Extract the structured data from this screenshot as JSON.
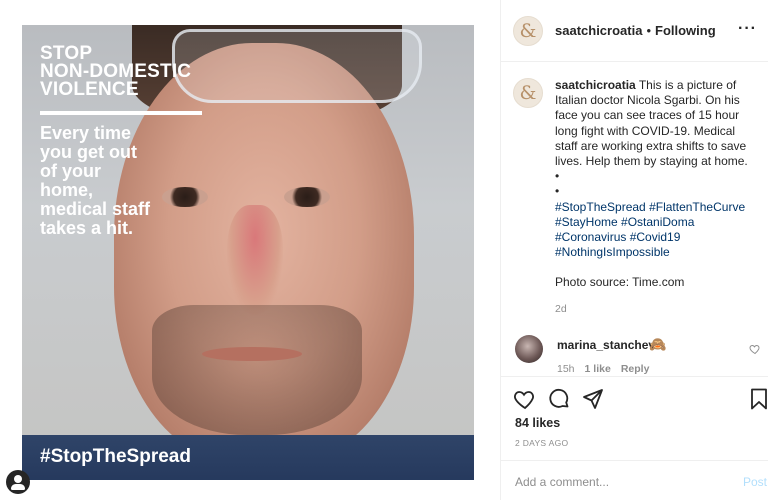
{
  "image_overlay": {
    "title_lines": [
      "STOP",
      "NON-DOMESTIC",
      "VIOLENCE"
    ],
    "message_lines": [
      "Every time",
      "you get out",
      "of your",
      "home,",
      "medical staff",
      "takes a hit."
    ],
    "hashtag": "#StopTheSpread"
  },
  "header": {
    "avatar_glyph": "&",
    "username": "saatchicroatia",
    "separator": "•",
    "follow_status": "Following",
    "more_icon": "more-icon"
  },
  "caption": {
    "avatar_glyph": "&",
    "username": "saatchicroatia",
    "text_lines": [
      "This is a picture of",
      "Italian doctor Nicola Sgarbi. On his",
      "face you can see traces of 15 hour",
      "long fight with COVID-19. Medical",
      "staff are working extra shifts to save",
      "lives. Help them by staying at home.",
      "•",
      "•"
    ],
    "hashtag_lines": [
      "#StopTheSpread #FlattenTheCurve",
      "#StayHome #OstaniDoma",
      "#Coronavirus #Covid19",
      "#NothingIsImpossible"
    ],
    "source": "Photo source: Time.com",
    "time_ago": "2d"
  },
  "comment": {
    "username": "marina_stanchev",
    "emoji": "🙈",
    "time": "15h",
    "likes": "1 like",
    "reply": "Reply"
  },
  "actions": {
    "icons": [
      "heart-icon",
      "comment-icon",
      "share-icon",
      "bookmark-icon"
    ]
  },
  "likes": "84 likes",
  "date": "2 DAYS AGO",
  "comment_box": {
    "placeholder": "Add a comment...",
    "post_label": "Post"
  },
  "colors": {
    "hashtag_link": "#003569",
    "muted_text": "#8e8e8e",
    "post_disabled": "#b2dffc",
    "divider": "#efefef"
  }
}
